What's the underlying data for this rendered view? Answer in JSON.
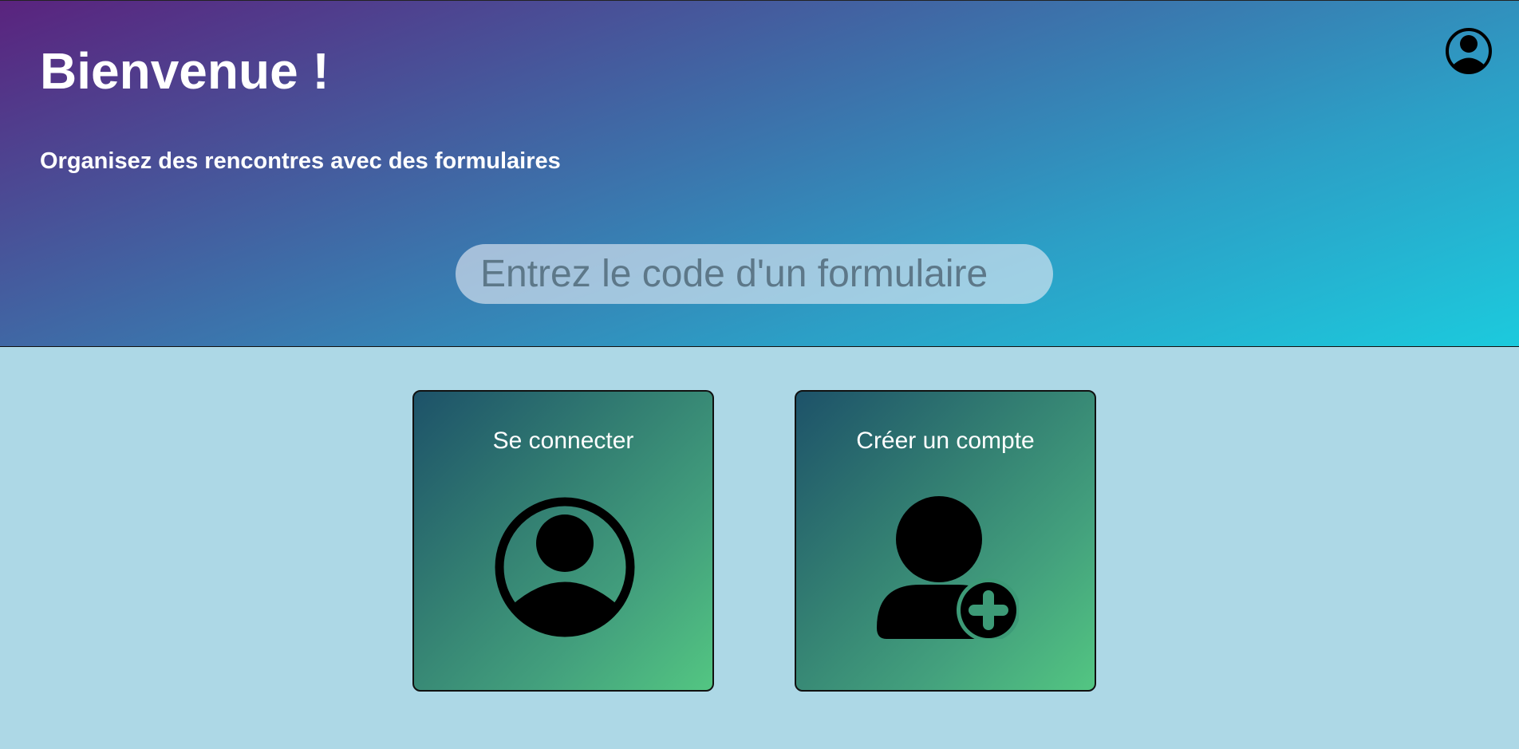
{
  "header": {
    "title": "Bienvenue !",
    "subtitle": "Organisez des rencontres avec des formulaires",
    "account_icon": "user-circle-icon"
  },
  "search": {
    "placeholder": "Entrez le code d'un formulaire",
    "value": ""
  },
  "cards": [
    {
      "label": "Se connecter",
      "icon": "user-circle-icon"
    },
    {
      "label": "Créer un compte",
      "icon": "user-plus-icon"
    }
  ],
  "colors": {
    "header_gradient_start": "#5a237e",
    "header_gradient_end": "#1ccadd",
    "page_background": "#add8e6",
    "card_gradient_start": "#1d5269",
    "card_gradient_end": "#53c682",
    "text": "#ffffff"
  }
}
